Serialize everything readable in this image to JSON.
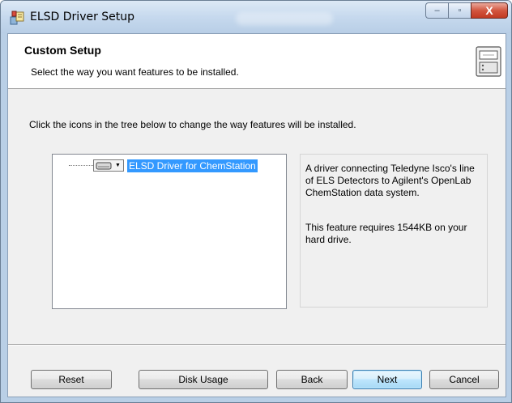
{
  "window": {
    "title": "ELSD Driver Setup"
  },
  "banner": {
    "title": "Custom Setup",
    "subtitle": "Select the way you want features to be installed."
  },
  "instructions": "Click the icons in the tree below to change the way features will be installed.",
  "feature_tree": {
    "items": [
      {
        "label": "ELSD Driver for ChemStation",
        "selected": true,
        "icon": "hard-drive-icon"
      }
    ]
  },
  "description": {
    "text": "A driver connecting Teledyne Isco's line of ELS Detectors to Agilent's OpenLab ChemStation data system.",
    "requirement": "This feature requires 1544KB on your hard drive."
  },
  "buttons": {
    "reset": "Reset",
    "disk_usage": "Disk Usage",
    "back": "Back",
    "next": "Next",
    "cancel": "Cancel"
  },
  "caption_buttons": {
    "minimize": "–",
    "maximize": "▫",
    "close": "X"
  },
  "colors": {
    "selection": "#3399ff",
    "titlebar": "#c6d9ee",
    "close_button": "#c23a22"
  }
}
